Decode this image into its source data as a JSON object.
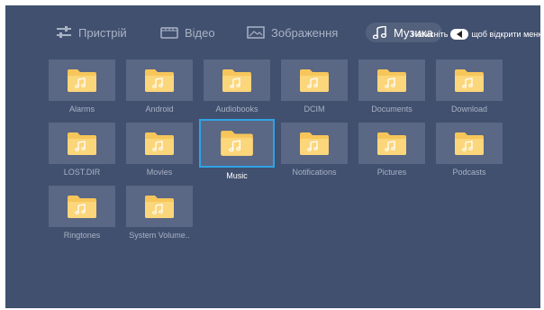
{
  "tabs": [
    {
      "label": "Пристрій",
      "icon": "sliders-icon"
    },
    {
      "label": "Відео",
      "icon": "film-icon"
    },
    {
      "label": "Зображення",
      "icon": "image-icon"
    },
    {
      "label": "Музика",
      "icon": "music-note-icon",
      "active": true
    }
  ],
  "hint": {
    "before": "Натисніть",
    "after": "щоб відкрити меню",
    "key_icon": "left-arrow-key-icon"
  },
  "folders": [
    {
      "label": "Alarms"
    },
    {
      "label": "Android"
    },
    {
      "label": "Audiobooks"
    },
    {
      "label": "DCIM"
    },
    {
      "label": "Documents"
    },
    {
      "label": "Download"
    },
    {
      "label": "LOST.DIR"
    },
    {
      "label": "Movies"
    },
    {
      "label": "Music",
      "focused": true
    },
    {
      "label": "Notifications"
    },
    {
      "label": "Pictures"
    },
    {
      "label": "Podcasts"
    },
    {
      "label": "Ringtones"
    },
    {
      "label": "System Volume.."
    }
  ],
  "colors": {
    "background": "#41506f",
    "tile": "#5a6785",
    "focus": "#2fa3e6",
    "folder": "#f7c65a"
  }
}
